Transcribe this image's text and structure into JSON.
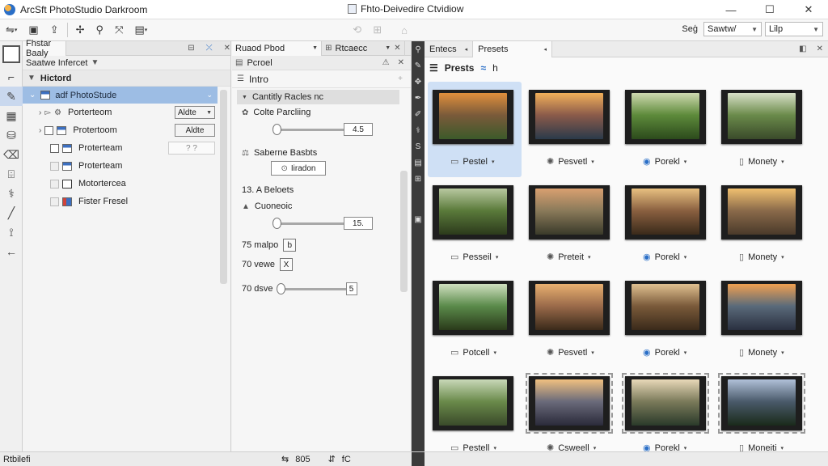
{
  "window": {
    "app_title": "ArcSft PhotoStudio Darkroom",
    "doc_title": "Fhto-Deivedire Ctvidiow",
    "controls": {
      "minimize": "—",
      "maximize": "☐",
      "close": "✕"
    }
  },
  "toolbar": {
    "right_label": "Sеģ",
    "select_1": "Sawtw/",
    "select_2": "Lilp"
  },
  "library": {
    "header_tab": "Fhstar Baaly",
    "sub_label": "Saatwe Infercet",
    "root_label": "Hictord",
    "selected_item": "adf  PhotoStude",
    "items": [
      {
        "label": "Porterteom",
        "button": "Aldte"
      },
      {
        "label": "Protertoom",
        "button": "Aldte"
      },
      {
        "label": "Proterteam",
        "button": "? ?"
      },
      {
        "label": "Proterteam",
        "button": ""
      },
      {
        "label": "Motortercea",
        "button": ""
      },
      {
        "label": "Fister Fresel",
        "button": ""
      }
    ]
  },
  "adjust": {
    "tab_1": "Ruaod Pbod",
    "tab_2": "Rtcaecc",
    "sub_label": "Pcroel",
    "intro_label": "Intro",
    "section_label": "Cantitly Racles nc",
    "color_label": "Colte Parcliing",
    "slider_1_value": "4.5",
    "balance_label": "Saberne Basbts",
    "balance_button": "Iiradon",
    "selects_label": "13. A Beloets",
    "curve_label": "Cuoneoic",
    "slider_2_value": "15.",
    "row_1_label": "75 malpo",
    "row_1_value": "b",
    "row_2_label": "70 vewe",
    "row_2_value": "X",
    "row_3_label": "70 dsve",
    "row_3_value": "5"
  },
  "presets": {
    "tab_1": "Entecs",
    "tab_2": "Presets",
    "heading": "Prests",
    "heading_extra": "h",
    "items": [
      {
        "label": "Pestel",
        "colors": [
          "#e08f3c",
          "#7a5a3a",
          "#3c5a2a"
        ],
        "selected": true
      },
      {
        "label": "Pesvetl",
        "colors": [
          "#f2b05a",
          "#8a5a4a",
          "#2a3a4a"
        ]
      },
      {
        "label": "Porekl",
        "colors": [
          "#cfd9b0",
          "#5d8a3a",
          "#2c4a1c"
        ]
      },
      {
        "label": "Monety",
        "colors": [
          "#d8e0c8",
          "#6a8a4a",
          "#3a4a2a"
        ]
      },
      {
        "label": "Pesseil",
        "colors": [
          "#b8c8a0",
          "#5a7a3a",
          "#2c3a1c"
        ]
      },
      {
        "label": "Preteit",
        "colors": [
          "#d9a070",
          "#8a7a5a",
          "#3a3a2a"
        ]
      },
      {
        "label": "Porekl",
        "colors": [
          "#e8c080",
          "#8a6040",
          "#3a2a1a"
        ]
      },
      {
        "label": "Monety",
        "colors": [
          "#f0c070",
          "#8a6a4a",
          "#4a3a2a"
        ]
      },
      {
        "label": "Potcell",
        "colors": [
          "#d0e0c0",
          "#5a8a4a",
          "#2a3a1a"
        ]
      },
      {
        "label": "Pesvetl",
        "colors": [
          "#e8b070",
          "#9a6a4a",
          "#3a2a1a"
        ]
      },
      {
        "label": "Porekl",
        "colors": [
          "#e0c090",
          "#7a5a3a",
          "#3a2a1a"
        ]
      },
      {
        "label": "Monety",
        "colors": [
          "#f0a050",
          "#5a6a7a",
          "#2a3040"
        ]
      },
      {
        "label": "Pestell",
        "colors": [
          "#c8d8b8",
          "#6a8a4a",
          "#3a4a2a"
        ]
      },
      {
        "label": "Csweell",
        "colors": [
          "#f0c080",
          "#6a6a7a",
          "#2a2a3a"
        ],
        "dashed": true
      },
      {
        "label": "Porekl",
        "colors": [
          "#e8d8b8",
          "#7a7a5a",
          "#2a3a2a"
        ],
        "dashed": true
      },
      {
        "label": "Moneiti",
        "colors": [
          "#b0c0d8",
          "#4a5a6a",
          "#1a2a1a"
        ],
        "dashed": true
      }
    ]
  },
  "status": {
    "left": "Rtbilefi",
    "value": "805",
    "extra": "fC"
  }
}
